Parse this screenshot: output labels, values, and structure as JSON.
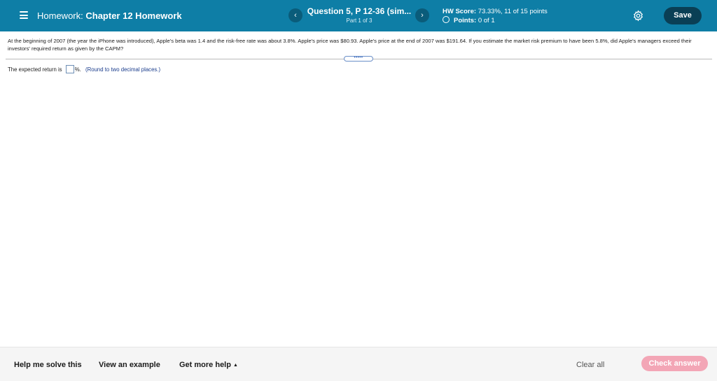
{
  "header": {
    "menu_icon": "hamburger-icon",
    "homework_prefix": "Homework:",
    "homework_name": "Chapter 12 Homework",
    "prev_label": "‹",
    "next_label": "›",
    "question_title": "Question 5, P 12-36 (sim...",
    "question_part": "Part 1 of 3",
    "score_label": "HW Score:",
    "score_value": "73.33%, 11 of 15 points",
    "points_label": "Points:",
    "points_value": "0 of 1",
    "settings_icon": "gear-icon",
    "save_label": "Save",
    "colors": {
      "bar": "#0e7ea6",
      "save": "#0a3f55"
    }
  },
  "question": {
    "text": "At the beginning of 2007 (the year the iPhone was introduced), Apple's beta was 1.4 and the risk-free rate was about 3.8%. Apple's price was $80.93. Apple's price at the end of 2007 was $191.64. If you estimate the market risk premium to have been 5.8%, did Apple's managers exceed their investors' required return as given by the CAPM?",
    "handle_label": "•••••"
  },
  "answer": {
    "prefix": "The expected return is",
    "suffix": "%.",
    "hint": "(Round to two decimal places.)",
    "value": ""
  },
  "footer": {
    "help_label": "Help me solve this",
    "example_label": "View an example",
    "more_help_label": "Get more help",
    "more_help_caret": "▲",
    "clear_label": "Clear all",
    "check_label": "Check answer",
    "colors": {
      "check": "#f3a6b6"
    }
  }
}
